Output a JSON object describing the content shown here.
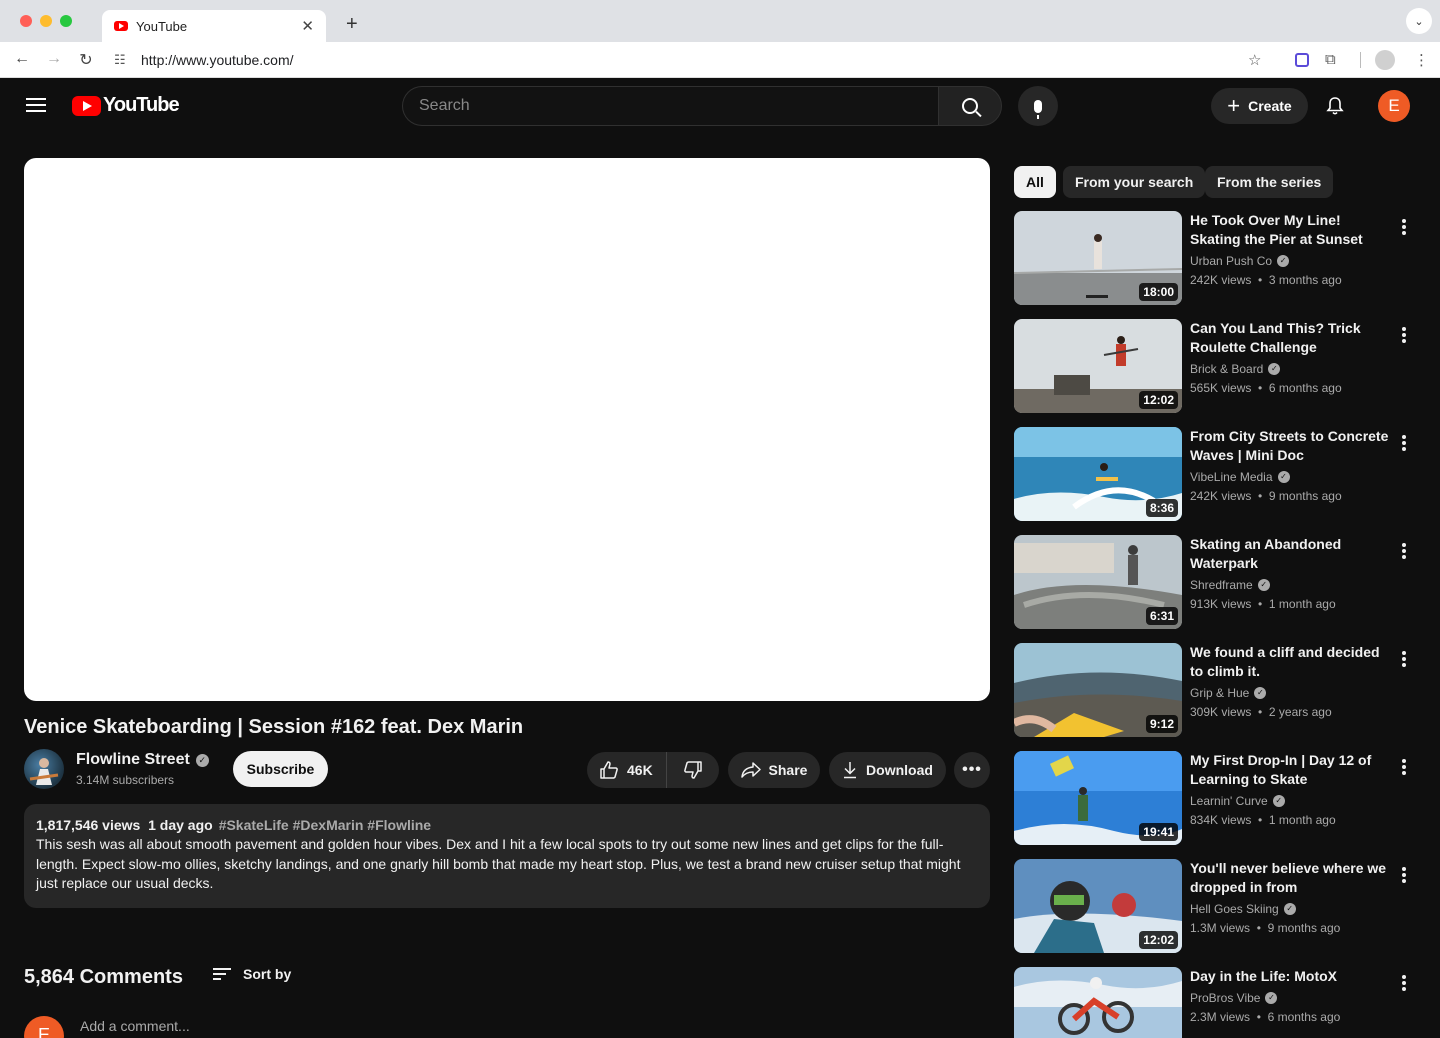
{
  "browser": {
    "tab_title": "YouTube",
    "url": "http://www.youtube.com/"
  },
  "header": {
    "logo_text": "YouTube",
    "search_placeholder": "Search",
    "create_label": "Create",
    "avatar_letter": "E"
  },
  "video": {
    "title": "Venice Skateboarding | Session #162 feat. Dex Marin",
    "channel_name": "Flowline Street",
    "subscribers": "3.14M subscribers",
    "subscribe_label": "Subscribe",
    "likes": "46K",
    "share_label": "Share",
    "download_label": "Download",
    "views": "1,817,546 views",
    "date": "1 day ago",
    "tags": "#SkateLife #DexMarin #Flowline",
    "description": "This sesh was all about smooth pavement and golden hour vibes. Dex and I hit a few local spots to try out some new lines and get clips for the full-length. Expect slow-mo ollies, sketchy landings, and one gnarly hill bomb that made my heart stop. Plus, we test a brand new cruiser setup that might just replace our usual decks."
  },
  "comments": {
    "count": "5,864 Comments",
    "sort_label": "Sort by",
    "avatar_letter": "E",
    "placeholder": "Add a comment..."
  },
  "chips": [
    "All",
    "From your search",
    "From the series"
  ],
  "recommendations": [
    {
      "title": "He Took Over My Line! Skating the Pier at Sunset",
      "channel": "Urban Push Co",
      "views": "242K views",
      "age": "3 months ago",
      "duration": "18:00"
    },
    {
      "title": "Can You Land This? Trick Roulette Challenge",
      "channel": "Brick & Board",
      "views": "565K views",
      "age": "6 months ago",
      "duration": "12:02"
    },
    {
      "title": "From City Streets to Concrete Waves | Mini Doc",
      "channel": "VibeLine Media",
      "views": "242K views",
      "age": "9 months ago",
      "duration": "8:36"
    },
    {
      "title": "Skating an Abandoned Waterpark",
      "channel": "Shredframe",
      "views": "913K views",
      "age": "1 month ago",
      "duration": "6:31"
    },
    {
      "title": "We found a cliff and decided to climb it.",
      "channel": "Grip & Hue",
      "views": "309K views",
      "age": "2 years ago",
      "duration": "9:12"
    },
    {
      "title": "My First Drop-In | Day 12 of Learning to Skate",
      "channel": "Learnin' Curve",
      "views": "834K views",
      "age": "1 month ago",
      "duration": "19:41"
    },
    {
      "title": "You'll never believe where we dropped in from",
      "channel": "Hell Goes Skiing",
      "views": "1.3M views",
      "age": "9 months ago",
      "duration": "12:02"
    },
    {
      "title": "Day in the Life: MotoX",
      "channel": "ProBros Vibe",
      "views": "2.3M views",
      "age": "6 months ago",
      "duration": ""
    }
  ]
}
